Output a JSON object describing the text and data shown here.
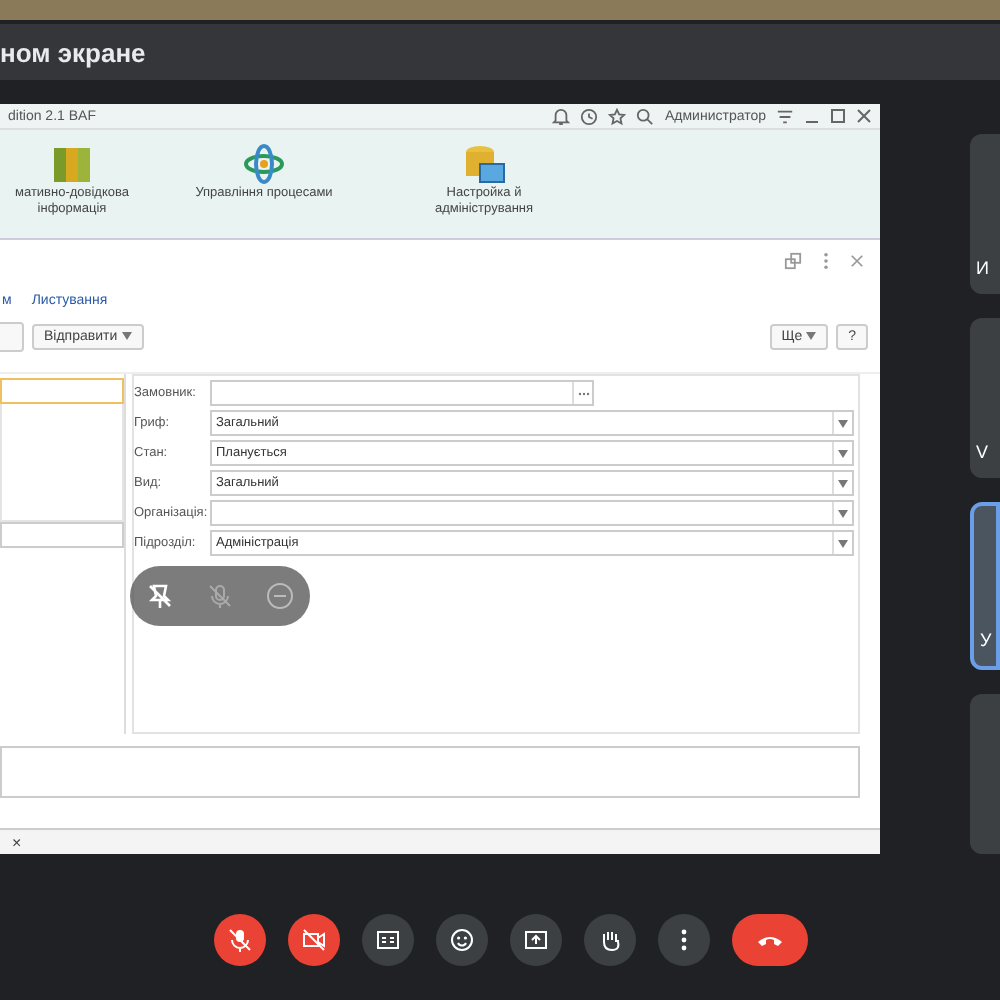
{
  "meeting": {
    "title": "ном экране"
  },
  "app": {
    "title": "dition 2.1 BAF",
    "user": "Администратор",
    "sections": [
      {
        "kind": "books",
        "label": "мативно-довідкова інформація"
      },
      {
        "kind": "process",
        "label": "Управління процесами"
      },
      {
        "kind": "settings",
        "label": "Настройка й адміністрування"
      }
    ],
    "links": [
      "м",
      "Листування"
    ],
    "buttons": [
      "Відправити"
    ],
    "more_button": "Ще",
    "help_button": "?",
    "fields": [
      {
        "label": "Замовник:",
        "kind": "select"
      },
      {
        "label": "Гриф:",
        "value": "Загальний",
        "kind": "dropdown"
      },
      {
        "label": "Стан:",
        "value": "Планується",
        "kind": "dropdown"
      },
      {
        "label": "Вид:",
        "value": "Загальний",
        "kind": "dropdown"
      },
      {
        "label": "Організація:",
        "kind": "dropdown"
      },
      {
        "label": "Підрозділ:",
        "value": "Адміністрація",
        "kind": "dropdown"
      }
    ],
    "tab_close": "×"
  },
  "tiles": [
    {
      "initial": "И",
      "speaking": false
    },
    {
      "initial": "V",
      "speaking": false
    },
    {
      "initial": "У",
      "speaking": true
    },
    {
      "speaking": false
    }
  ],
  "controls": [
    {
      "kind": "mic",
      "off": true
    },
    {
      "kind": "camera",
      "off": true
    },
    {
      "kind": "captions",
      "off": false
    },
    {
      "kind": "emoji",
      "off": false
    },
    {
      "kind": "present",
      "off": false
    },
    {
      "kind": "hand",
      "off": false
    },
    {
      "kind": "more",
      "off": false
    },
    {
      "kind": "hangup",
      "off": true
    }
  ]
}
